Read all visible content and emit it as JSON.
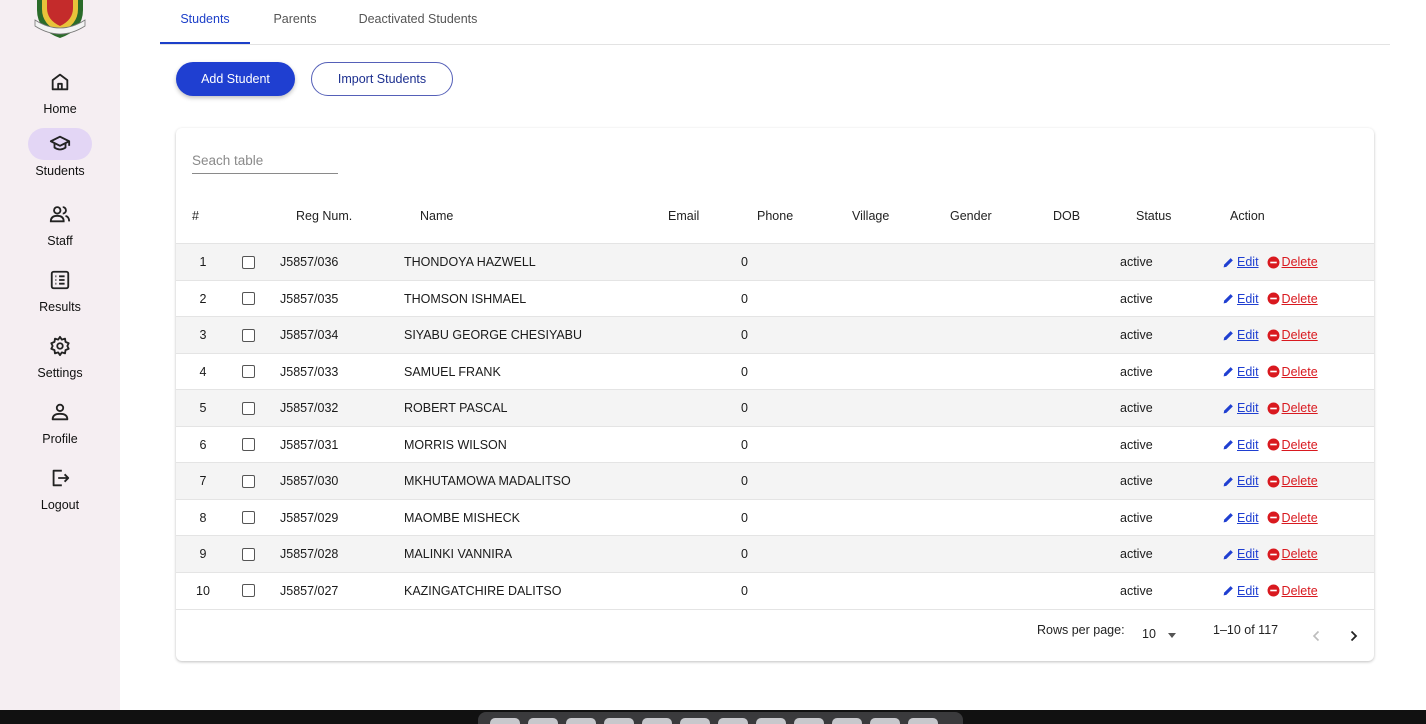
{
  "sidebar": {
    "items": [
      {
        "label": "Home",
        "icon": "home-icon",
        "active": false
      },
      {
        "label": "Students",
        "icon": "graduation-cap-icon",
        "active": true
      },
      {
        "label": "Staff",
        "icon": "people-icon",
        "active": false
      },
      {
        "label": "Results",
        "icon": "list-icon",
        "active": false
      },
      {
        "label": "Settings",
        "icon": "gear-icon",
        "active": false
      },
      {
        "label": "Profile",
        "icon": "person-icon",
        "active": false
      },
      {
        "label": "Logout",
        "icon": "logout-icon",
        "active": false
      }
    ]
  },
  "tabs": [
    {
      "label": "Students",
      "active": true
    },
    {
      "label": "Parents",
      "active": false
    },
    {
      "label": "Deactivated Students",
      "active": false
    }
  ],
  "actions": {
    "add_label": "Add Student",
    "import_label": "Import Students"
  },
  "search": {
    "placeholder": "Seach table"
  },
  "table": {
    "columns": [
      "#",
      "Reg Num.",
      "Name",
      "Email",
      "Phone",
      "Village",
      "Gender",
      "DOB",
      "Status",
      "Action"
    ],
    "edit_label": "Edit",
    "delete_label": "Delete",
    "rows": [
      {
        "num": "1",
        "reg": "J5857/036",
        "name": "THONDOYA HAZWELL",
        "phone": "0",
        "status": "active"
      },
      {
        "num": "2",
        "reg": "J5857/035",
        "name": "THOMSON ISHMAEL",
        "phone": "0",
        "status": "active"
      },
      {
        "num": "3",
        "reg": "J5857/034",
        "name": "SIYABU GEORGE CHESIYABU",
        "phone": "0",
        "status": "active"
      },
      {
        "num": "4",
        "reg": "J5857/033",
        "name": "SAMUEL FRANK",
        "phone": "0",
        "status": "active"
      },
      {
        "num": "5",
        "reg": "J5857/032",
        "name": "ROBERT PASCAL",
        "phone": "0",
        "status": "active"
      },
      {
        "num": "6",
        "reg": "J5857/031",
        "name": "MORRIS WILSON",
        "phone": "0",
        "status": "active"
      },
      {
        "num": "7",
        "reg": "J5857/030",
        "name": "MKHUTAMOWA MADALITSO",
        "phone": "0",
        "status": "active"
      },
      {
        "num": "8",
        "reg": "J5857/029",
        "name": "MAOMBE MISHECK",
        "phone": "0",
        "status": "active"
      },
      {
        "num": "9",
        "reg": "J5857/028",
        "name": "MALINKI VANNIRA",
        "phone": "0",
        "status": "active"
      },
      {
        "num": "10",
        "reg": "J5857/027",
        "name": "KAZINGATCHIRE DALITSO",
        "phone": "0",
        "status": "active"
      }
    ]
  },
  "pagination": {
    "rows_per_page_label": "Rows per page:",
    "rows_per_page_value": "10",
    "range_label": "1–10 of 117"
  },
  "colors": {
    "primary": "#1f3fd1",
    "danger": "#d9191f",
    "sidebar_bg": "#f5eef2",
    "active_nav_bg": "#e3d6f5"
  }
}
